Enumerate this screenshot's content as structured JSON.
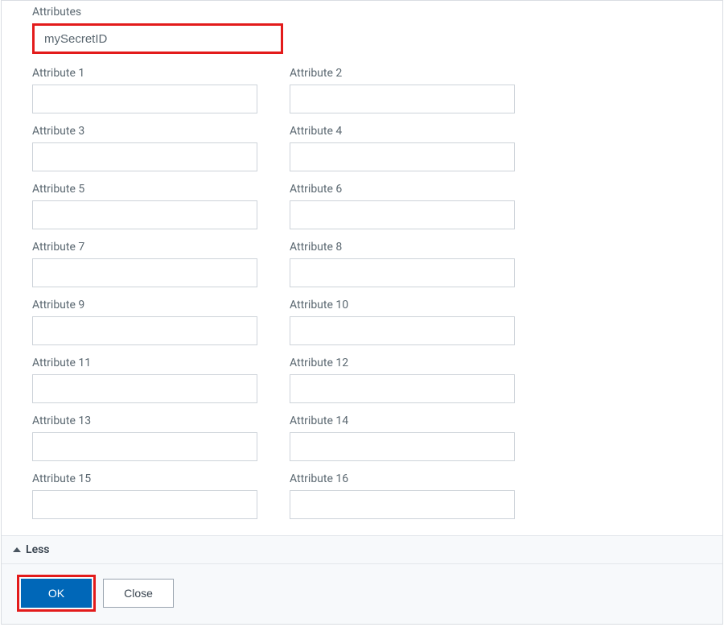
{
  "section_label": "Attributes",
  "secret_value": "mySecretID",
  "attributes": [
    {
      "label": "Attribute 1",
      "value": ""
    },
    {
      "label": "Attribute 2",
      "value": ""
    },
    {
      "label": "Attribute 3",
      "value": ""
    },
    {
      "label": "Attribute 4",
      "value": ""
    },
    {
      "label": "Attribute 5",
      "value": ""
    },
    {
      "label": "Attribute 6",
      "value": ""
    },
    {
      "label": "Attribute 7",
      "value": ""
    },
    {
      "label": "Attribute 8",
      "value": ""
    },
    {
      "label": "Attribute 9",
      "value": ""
    },
    {
      "label": "Attribute 10",
      "value": ""
    },
    {
      "label": "Attribute 11",
      "value": ""
    },
    {
      "label": "Attribute 12",
      "value": ""
    },
    {
      "label": "Attribute 13",
      "value": ""
    },
    {
      "label": "Attribute 14",
      "value": ""
    },
    {
      "label": "Attribute 15",
      "value": ""
    },
    {
      "label": "Attribute 16",
      "value": ""
    }
  ],
  "toggle_label": "Less",
  "buttons": {
    "ok": "OK",
    "close": "Close"
  }
}
